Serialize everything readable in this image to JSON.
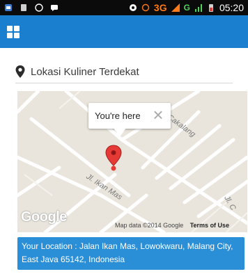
{
  "status_bar": {
    "network": "3G",
    "network_secondary": "G",
    "time": "05:20"
  },
  "header": {
    "title": "Lokasi Kuliner Terdekat"
  },
  "map": {
    "bubble_text": "You're here",
    "close_glyph": "×",
    "streets": [
      {
        "name": "Cakalang"
      },
      {
        "name": "Jl. Ikan Mas"
      },
      {
        "name": "Jl. C"
      }
    ],
    "logo_text": "Google",
    "map_data_text": "Map data ©2014 Google",
    "terms_text": "Terms of Use"
  },
  "location": {
    "text": "Your Location : Jalan Ikan Mas, Lowokwaru, Malang City, East Java 65142, Indonesia"
  },
  "colors": {
    "app_bar": "#1b7fcf",
    "location_box": "#2a8fd6",
    "marker": "#e53935"
  }
}
